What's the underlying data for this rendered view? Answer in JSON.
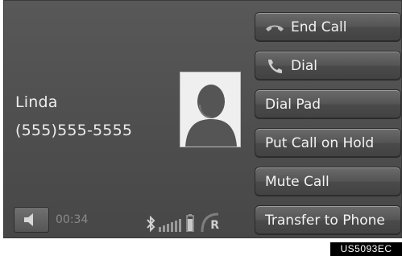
{
  "caller": {
    "name": "Linda",
    "number": "(555)555-5555",
    "photo_icon": "contact-silhouette-icon"
  },
  "buttons": [
    {
      "id": "end-call",
      "label": "End Call",
      "icon": "handset-hangup-icon"
    },
    {
      "id": "dial",
      "label": "Dial",
      "icon": "handset-icon"
    },
    {
      "id": "dial-pad",
      "label": "Dial Pad"
    },
    {
      "id": "hold",
      "label": "Put Call on Hold"
    },
    {
      "id": "mute",
      "label": "Mute Call"
    },
    {
      "id": "transfer",
      "label": "Transfer to Phone"
    }
  ],
  "status_bar": {
    "speaker_icon": "speaker-icon",
    "call_time": "00:34",
    "bluetooth_icon": "bluetooth-icon",
    "signal_icon": "signal-strength-icon",
    "battery_icon": "battery-icon",
    "roaming_label": "R"
  },
  "doc_code": "US5093EC",
  "colors": {
    "screen_bg": "#4e4e4e",
    "button_bg": "#555555",
    "text": "#ececec",
    "timer_text": "#8a8a8a"
  }
}
